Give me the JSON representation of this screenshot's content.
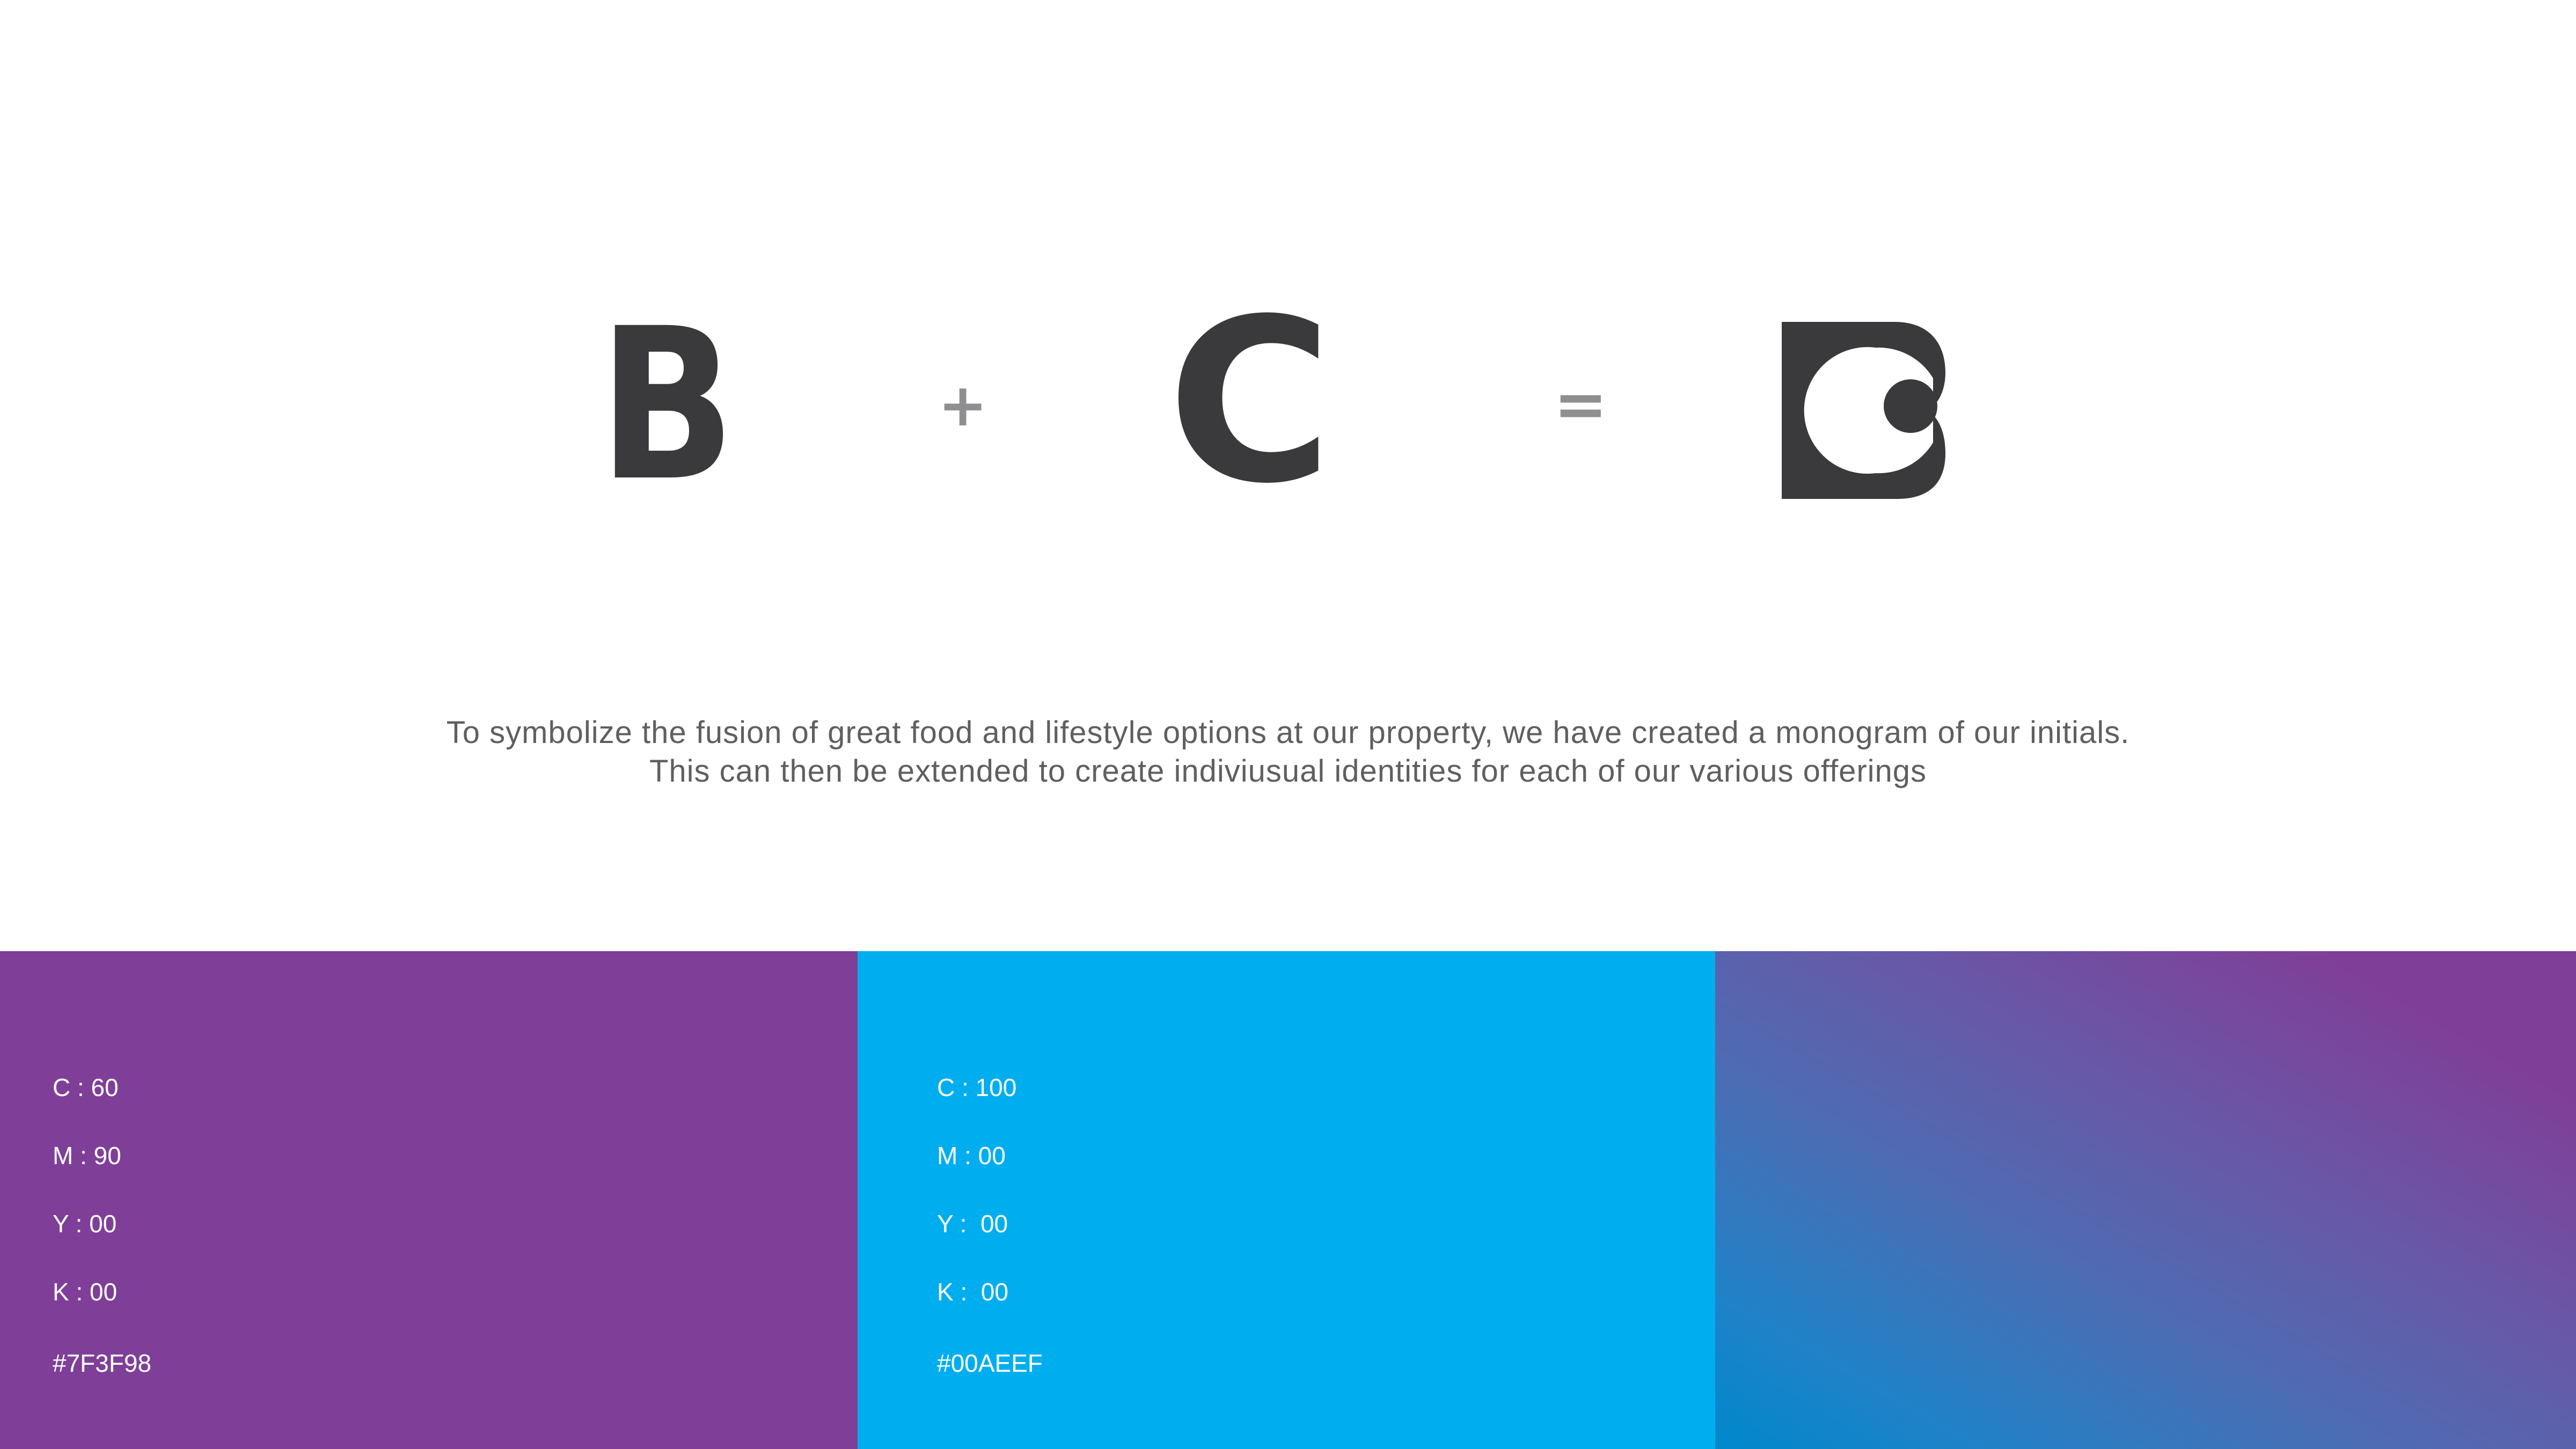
{
  "equation": {
    "first_letter": "B",
    "plus": "+",
    "second_letter": "C",
    "equals": "=",
    "result_icon": "bc-monogram-logo",
    "letter_color": "#3A3A3C",
    "operator_color": "#8F8F91"
  },
  "tagline": {
    "line1": "To symbolize the fusion of great food and lifestyle options at our property, we have created a monogram of our initials.",
    "line2": "This can then be extended to create indiviusual identities for each of our various offerings"
  },
  "palette": {
    "swatches": [
      {
        "color": "#7F3F98",
        "c": "C : 60",
        "m": "M : 90",
        "y": "Y : 00",
        "k": "K : 00",
        "hex": "#7F3F98"
      },
      {
        "color": "#00AEEF",
        "c": "C : 100",
        "m": "M : 00",
        "y": "Y :  00",
        "k": "K :  00",
        "hex": "#00AEEF"
      },
      {
        "gradient_from": "#0088CC",
        "gradient_to": "#7F3F98",
        "type": "gradient"
      }
    ]
  }
}
